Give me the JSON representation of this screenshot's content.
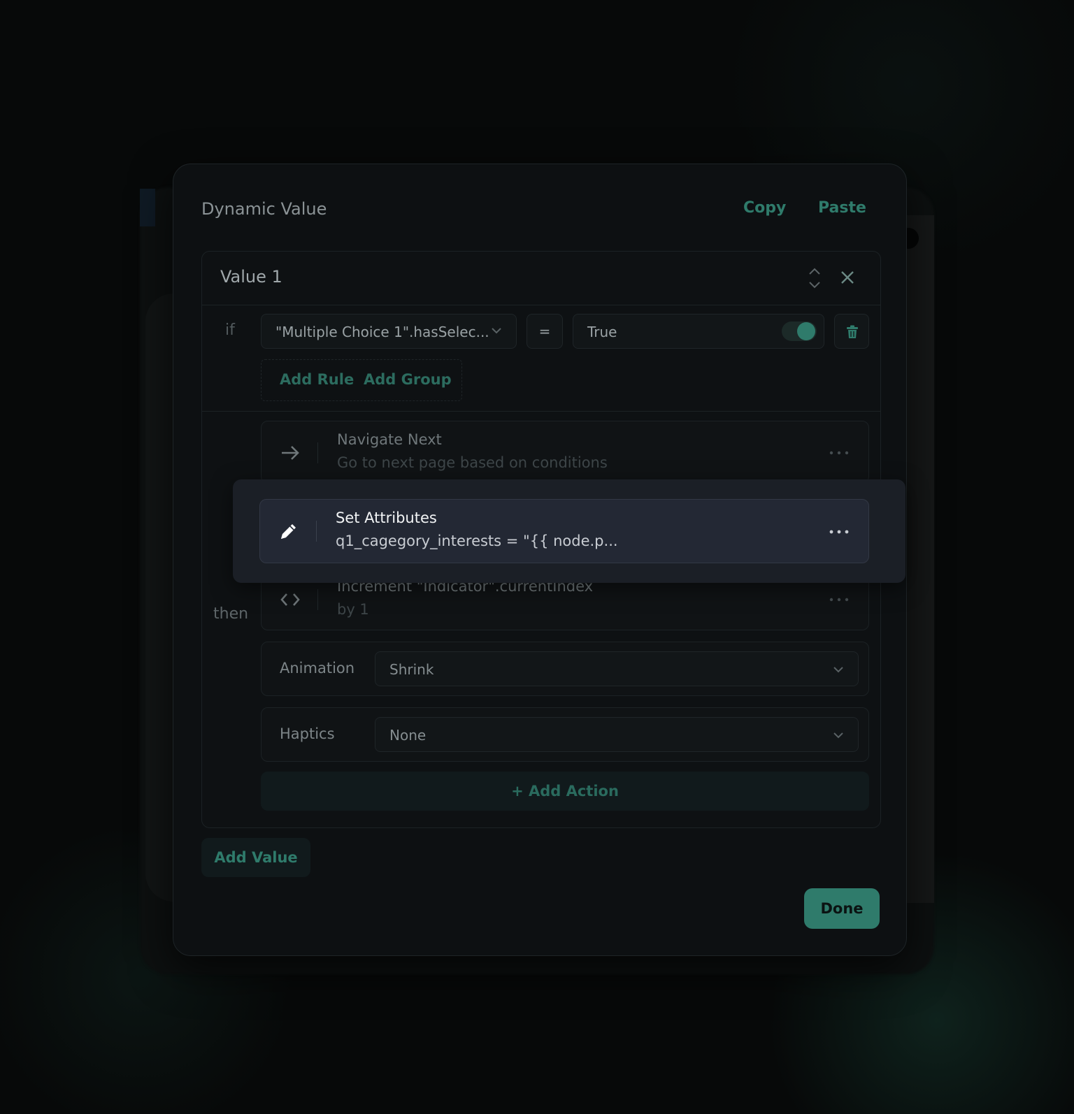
{
  "modal": {
    "title": "Dynamic Value",
    "copy_label": "Copy",
    "paste_label": "Paste",
    "add_value_label": "Add Value",
    "done_label": "Done"
  },
  "value": {
    "title": "Value 1",
    "if_label": "if",
    "condition": {
      "field": "\"Multiple Choice 1\".hasSelec...",
      "operator": "=",
      "value": "True",
      "toggle_on": true
    },
    "add_rule_label": "Add Rule",
    "add_group_label": "Add Group",
    "then_label": "then",
    "actions": [
      {
        "title": "Navigate Next",
        "subtitle": "Go to next page based on conditions",
        "icon": "arrow-right-icon"
      },
      {
        "title": "Set Attributes",
        "subtitle": "q1_cagegory_interests = \"{{ node.p...",
        "icon": "pencil-icon",
        "highlighted": true
      },
      {
        "title": "Increment \"Indicator\".currentIndex",
        "subtitle": "by 1",
        "icon": "code-brackets-icon"
      }
    ],
    "animation": {
      "label": "Animation",
      "selected": "Shrink"
    },
    "haptics": {
      "label": "Haptics",
      "selected": "None"
    },
    "add_action_label": "+ Add Action"
  },
  "colors": {
    "accent": "#2f7b6b",
    "background": "#070909",
    "modal_bg": "#0d1012",
    "highlight_card": "#232834"
  }
}
